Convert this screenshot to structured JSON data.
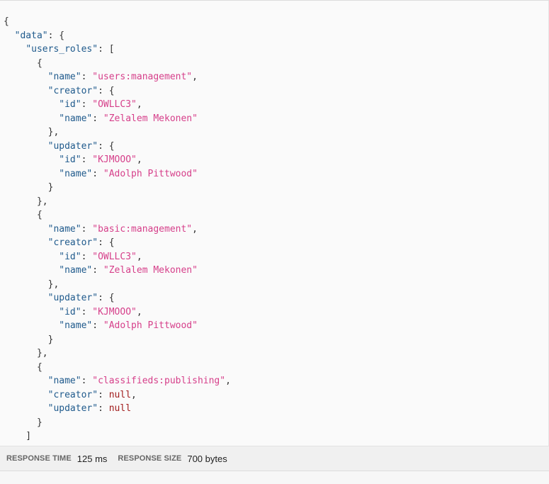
{
  "response_body": {
    "lines": [
      [
        {
          "t": "p",
          "v": "{"
        }
      ],
      [
        {
          "t": "p",
          "v": "  "
        },
        {
          "t": "k",
          "v": "\"data\""
        },
        {
          "t": "p",
          "v": ": {"
        }
      ],
      [
        {
          "t": "p",
          "v": "    "
        },
        {
          "t": "k",
          "v": "\"users_roles\""
        },
        {
          "t": "p",
          "v": ": ["
        }
      ],
      [
        {
          "t": "p",
          "v": "      {"
        }
      ],
      [
        {
          "t": "p",
          "v": "        "
        },
        {
          "t": "k",
          "v": "\"name\""
        },
        {
          "t": "p",
          "v": ": "
        },
        {
          "t": "s",
          "v": "\"users:management\""
        },
        {
          "t": "p",
          "v": ","
        }
      ],
      [
        {
          "t": "p",
          "v": "        "
        },
        {
          "t": "k",
          "v": "\"creator\""
        },
        {
          "t": "p",
          "v": ": {"
        }
      ],
      [
        {
          "t": "p",
          "v": "          "
        },
        {
          "t": "k",
          "v": "\"id\""
        },
        {
          "t": "p",
          "v": ": "
        },
        {
          "t": "s",
          "v": "\"OWLLC3\""
        },
        {
          "t": "p",
          "v": ","
        }
      ],
      [
        {
          "t": "p",
          "v": "          "
        },
        {
          "t": "k",
          "v": "\"name\""
        },
        {
          "t": "p",
          "v": ": "
        },
        {
          "t": "s",
          "v": "\"Zelalem Mekonen\""
        }
      ],
      [
        {
          "t": "p",
          "v": "        },"
        }
      ],
      [
        {
          "t": "p",
          "v": "        "
        },
        {
          "t": "k",
          "v": "\"updater\""
        },
        {
          "t": "p",
          "v": ": {"
        }
      ],
      [
        {
          "t": "p",
          "v": "          "
        },
        {
          "t": "k",
          "v": "\"id\""
        },
        {
          "t": "p",
          "v": ": "
        },
        {
          "t": "s",
          "v": "\"KJMOOO\""
        },
        {
          "t": "p",
          "v": ","
        }
      ],
      [
        {
          "t": "p",
          "v": "          "
        },
        {
          "t": "k",
          "v": "\"name\""
        },
        {
          "t": "p",
          "v": ": "
        },
        {
          "t": "s",
          "v": "\"Adolph Pittwood\""
        }
      ],
      [
        {
          "t": "p",
          "v": "        }"
        }
      ],
      [
        {
          "t": "p",
          "v": "      },"
        }
      ],
      [
        {
          "t": "p",
          "v": "      {"
        }
      ],
      [
        {
          "t": "p",
          "v": "        "
        },
        {
          "t": "k",
          "v": "\"name\""
        },
        {
          "t": "p",
          "v": ": "
        },
        {
          "t": "s",
          "v": "\"basic:management\""
        },
        {
          "t": "p",
          "v": ","
        }
      ],
      [
        {
          "t": "p",
          "v": "        "
        },
        {
          "t": "k",
          "v": "\"creator\""
        },
        {
          "t": "p",
          "v": ": {"
        }
      ],
      [
        {
          "t": "p",
          "v": "          "
        },
        {
          "t": "k",
          "v": "\"id\""
        },
        {
          "t": "p",
          "v": ": "
        },
        {
          "t": "s",
          "v": "\"OWLLC3\""
        },
        {
          "t": "p",
          "v": ","
        }
      ],
      [
        {
          "t": "p",
          "v": "          "
        },
        {
          "t": "k",
          "v": "\"name\""
        },
        {
          "t": "p",
          "v": ": "
        },
        {
          "t": "s",
          "v": "\"Zelalem Mekonen\""
        }
      ],
      [
        {
          "t": "p",
          "v": "        },"
        }
      ],
      [
        {
          "t": "p",
          "v": "        "
        },
        {
          "t": "k",
          "v": "\"updater\""
        },
        {
          "t": "p",
          "v": ": {"
        }
      ],
      [
        {
          "t": "p",
          "v": "          "
        },
        {
          "t": "k",
          "v": "\"id\""
        },
        {
          "t": "p",
          "v": ": "
        },
        {
          "t": "s",
          "v": "\"KJMOOO\""
        },
        {
          "t": "p",
          "v": ","
        }
      ],
      [
        {
          "t": "p",
          "v": "          "
        },
        {
          "t": "k",
          "v": "\"name\""
        },
        {
          "t": "p",
          "v": ": "
        },
        {
          "t": "s",
          "v": "\"Adolph Pittwood\""
        }
      ],
      [
        {
          "t": "p",
          "v": "        }"
        }
      ],
      [
        {
          "t": "p",
          "v": "      },"
        }
      ],
      [
        {
          "t": "p",
          "v": "      {"
        }
      ],
      [
        {
          "t": "p",
          "v": "        "
        },
        {
          "t": "k",
          "v": "\"name\""
        },
        {
          "t": "p",
          "v": ": "
        },
        {
          "t": "s",
          "v": "\"classifieds:publishing\""
        },
        {
          "t": "p",
          "v": ","
        }
      ],
      [
        {
          "t": "p",
          "v": "        "
        },
        {
          "t": "k",
          "v": "\"creator\""
        },
        {
          "t": "p",
          "v": ": "
        },
        {
          "t": "n",
          "v": "null"
        },
        {
          "t": "p",
          "v": ","
        }
      ],
      [
        {
          "t": "p",
          "v": "        "
        },
        {
          "t": "k",
          "v": "\"updater\""
        },
        {
          "t": "p",
          "v": ": "
        },
        {
          "t": "n",
          "v": "null"
        }
      ],
      [
        {
          "t": "p",
          "v": "      }"
        }
      ],
      [
        {
          "t": "p",
          "v": "    ]"
        }
      ]
    ]
  },
  "status_bar": {
    "response_time_label": "RESPONSE TIME",
    "response_time_value": "125 ms",
    "response_size_label": "RESPONSE SIZE",
    "response_size_value": "700 bytes"
  },
  "colors": {
    "key": "#1f5a8c",
    "string": "#d63f8a",
    "null": "#a11d1d",
    "punctuation": "#333333"
  }
}
